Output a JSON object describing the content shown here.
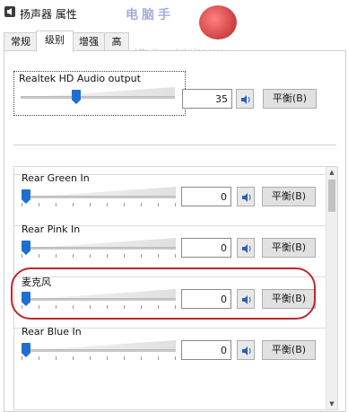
{
  "window": {
    "title": "扬声器 属性"
  },
  "watermark": {
    "text": "电脑手",
    "url": "http://www.kelaxing.com"
  },
  "tabs": [
    {
      "label": "常规"
    },
    {
      "label": "级别"
    },
    {
      "label": "增强"
    },
    {
      "label": "高"
    }
  ],
  "active_tab": 1,
  "master": {
    "label": "Realtek HD Audio output",
    "value": "35",
    "volume_percent": 35,
    "balance_label": "平衡(B)"
  },
  "channels": [
    {
      "label": "Rear Green In",
      "value": "0",
      "balance_label": "平衡(B)"
    },
    {
      "label": "Rear Pink In",
      "value": "0",
      "balance_label": "平衡(B)"
    },
    {
      "label": "麦克风",
      "value": "0",
      "balance_label": "平衡(B)"
    },
    {
      "label": "Rear Blue In",
      "value": "0",
      "balance_label": "平衡(B)"
    }
  ],
  "colors": {
    "accent": "#1f6fd1",
    "highlight": "#c0282c"
  }
}
